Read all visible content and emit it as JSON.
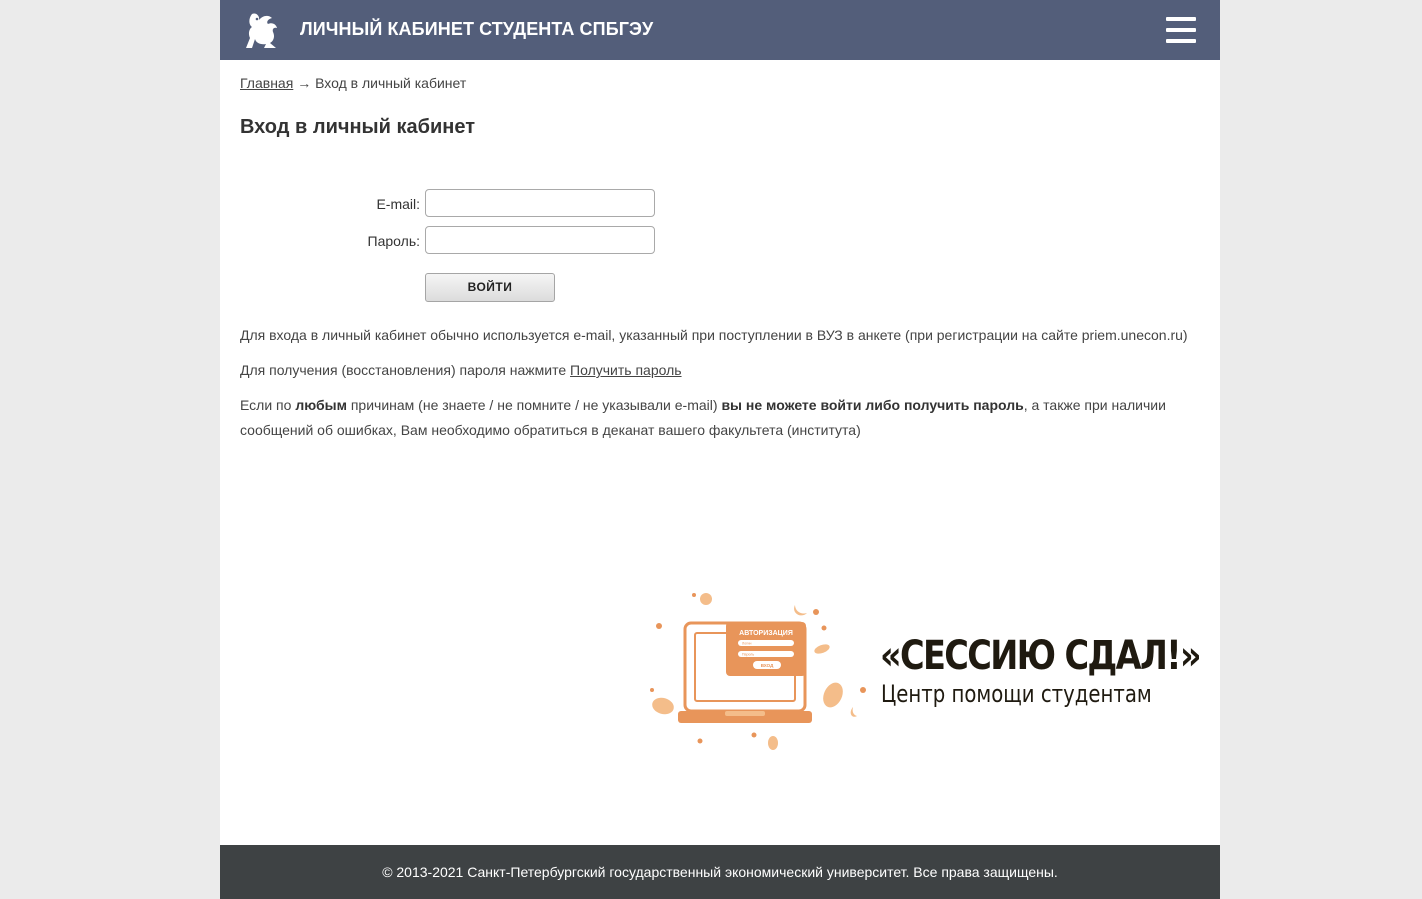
{
  "header": {
    "title": "ЛИЧНЫЙ КАБИНЕТ СТУДЕНТА СПБГЭУ",
    "logo_icon": "griffin-logo-icon",
    "menu_icon": "hamburger-menu-icon"
  },
  "breadcrumb": {
    "home": "Главная",
    "separator": "→",
    "current": "Вход в личный кабинет"
  },
  "main": {
    "heading": "Вход в личный кабинет",
    "form": {
      "email_label": "E-mail:",
      "email_value": "",
      "password_label": "Пароль:",
      "password_value": "",
      "submit_label": "войти"
    },
    "info1": "Для входа в личный кабинет обычно используется e-mail, указанный при поступлении в ВУЗ в анкете (при регистрации на сайте priem.unecon.ru)",
    "info2_prefix": "Для получения (восстановления) пароля нажмите",
    "info2_link": "Получить пароль",
    "info3": {
      "p1": "Если по",
      "b1": "любым",
      "p2": "причинам (не знаете / не помните / не указывали e-mail)",
      "b2": "вы не можете войти либо получить пароль",
      "p3": ", а также при наличии сообщений об ошибках, Вам необходимо обратиться в деканат вашего факультета (института)"
    }
  },
  "banner": {
    "title": "«СЕССИЮ СДАЛ!»",
    "subtitle": "Центр помощи студентам",
    "card_title": "АВТОРИЗАЦИЯ",
    "card_field1": "Логин",
    "card_field2": "Пароль",
    "card_button": "ВХОД",
    "accent_color": "#e8955a",
    "light_color": "#f4bd8a"
  },
  "footer": {
    "copyright": "© 2013-2021 Санкт-Петербургский государственный экономический университет. Все права защищены."
  },
  "colors": {
    "header_bg": "#535e7a",
    "footer_bg": "#3e4244",
    "page_bg": "#ebebeb"
  }
}
